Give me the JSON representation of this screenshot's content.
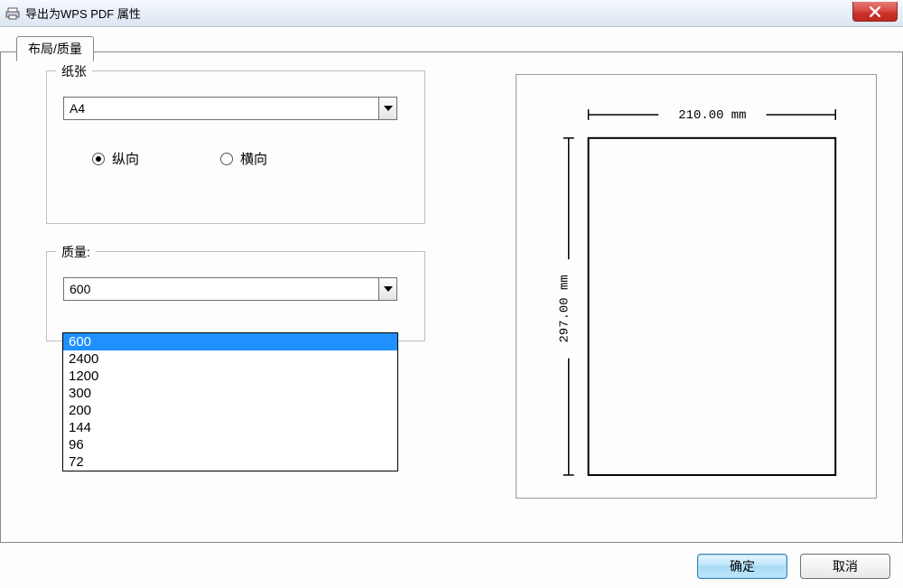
{
  "titlebar": {
    "title": "导出为WPS PDF 属性"
  },
  "tabs": {
    "layout_quality": "布局/质量"
  },
  "paper_group": {
    "legend": "纸张",
    "paper_size_value": "A4",
    "orientation": {
      "portrait": "纵向",
      "landscape": "横向",
      "selected": "portrait"
    }
  },
  "quality_group": {
    "legend": "质量:",
    "value": "600",
    "options": [
      "600",
      "2400",
      "1200",
      "300",
      "200",
      "144",
      "96",
      "72"
    ]
  },
  "preview": {
    "width_label": "210.00 mm",
    "height_label": "297.00 mm"
  },
  "buttons": {
    "ok": "确定",
    "cancel": "取消"
  }
}
